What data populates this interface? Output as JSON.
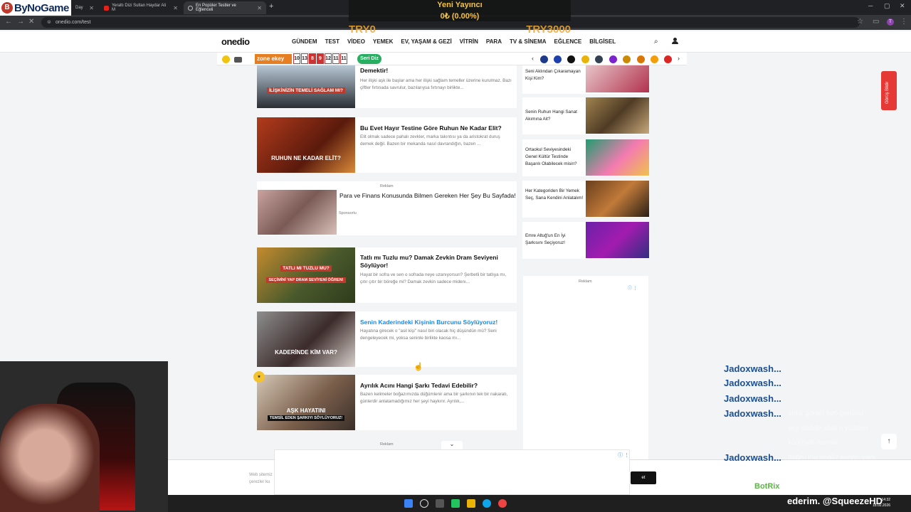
{
  "browser": {
    "tabs": [
      {
        "label": "Day",
        "active": false
      },
      {
        "label": "Yeraltı Dizi Sultan Haydar Ali M",
        "active": false
      },
      {
        "label": "En Popüler Testler ve Eğlenceli",
        "active": true
      }
    ],
    "url": "onedio.com/test",
    "profile_initial": "T"
  },
  "overlay": {
    "logo_text": "ByNoGame",
    "donation_title": "Yeni Yayıncı",
    "donation_value": "0₺ (0.00%)",
    "donation_min": "TRY0",
    "donation_max": "TRY3000"
  },
  "site": {
    "logo": "onedio",
    "nav": [
      "GÜNDEM",
      "TEST",
      "VİDEO",
      "YEMEK",
      "EV, YAŞAM & GEZİ",
      "VİTRİN",
      "PARA",
      "TV & SİNEMA",
      "EĞLENCE",
      "BİLGİSEL"
    ],
    "zone_logo": "zone ekey",
    "date_numbers": [
      "10",
      "13",
      "8",
      "9",
      "12",
      "11",
      "11"
    ],
    "seri_diz": "Seri Diz"
  },
  "articles": [
    {
      "title": "Demektir!",
      "desc": "Her ilişki aşk ile başlar ama her ilişki sağlam temeller üzerine kurulmaz. Bazı çiftler fırtınada savrulur, bazılarıysa fırtınayı birlikte...",
      "caption": "İLİŞKİNİZİN TEMELİ SAĞLAM MI?"
    },
    {
      "title": "Bu Evet Hayır Testine Göre Ruhun Ne Kadar Elit?",
      "desc": "Elit olmak sadece pahalı zevkler, marka takıntısı ya da aristokrat duruş demek değil. Bazen bir mekanda nasıl davrandığın, bazen ...",
      "caption": "RUHUN NE KADAR ELİT?"
    },
    {
      "title": "Tatlı mı Tuzlu mu? Damak Zevkin Dram Seviyeni Söylüyor!",
      "desc": "Hayat bir sofra ve sen o sofrada neye uzanıyorsun? Şerbetli bir tatlıya mı, çıtır çıtır bir böreğe mi? Damak zevkin sadece midenı...",
      "caption": "TATLI MI TUZLU MU?"
    },
    {
      "title": "Senin Kaderindeki Kişinin Burcunu Söylüyoruz!",
      "desc": "Hayatına girecek o \"asil kişi\" nasıl biri olacak hiç düşündün mü? Seni dengeleyecek mi, yoksa seninle birlikte kaosa mı...",
      "caption": "KADERİNDE KİM VAR?"
    },
    {
      "title": "Ayrılık Acını Hangi Şarkı Tedavi Edebilir?",
      "desc": "Bazen kelimeler boğazımızda düğümlenir ama bir şarkının tek bir nakaratı, günlerdir anlatamadığımız her şeyi haykırır. Ayrılık,...",
      "caption": "AŞK HAYATINI"
    }
  ],
  "captions_extra": {
    "tatli_sub": "SEÇİMİNİ YAP DRAM SEVİYENİ ÖĞREN!",
    "ask_sub": "TEMSİL EDEN ŞARKIYI SÖYLÜYORUZ!"
  },
  "sponsored": {
    "reklam": "Reklam",
    "title": "Para ve Finans Konusunda Bilmen Gereken Her Şey Bu Sayfada!",
    "label": "Sponsorlu"
  },
  "sidebar": [
    {
      "text": "Seni Aklından Çıkaramayan Kişi Kim?"
    },
    {
      "text": "Senin Ruhun Hangi Sanat Akımına Ait?"
    },
    {
      "text": "Ortaokul Seviyesindeki Genel Kültür Testinde Başarılı Olabilecek misin?"
    },
    {
      "text": "Her Kategoriden Bir Yemek Seç, Sana Kendini Anlatalım!"
    },
    {
      "text": "Emre Altuğ'un En İyi Şarkısını Seçiyoruz!"
    }
  ],
  "side_reklam": "Reklam",
  "bottom_reklam": "Reklam",
  "feedback": "Görüş Bildir",
  "cookie": {
    "text": "Web sitemiz çerezler ku",
    "ok": "et"
  },
  "chat": {
    "names": [
      "Jadoxwash...",
      "Jadoxwash...",
      "Jadoxwash...",
      "Jadoxwash...",
      "Jadoxwash..."
    ],
    "messages": [
      "anlık görsel son görüldü",
      "şey olabilir abla o yüzden",
      "korkmak normal",
      "doğru mu analiz ediyor yani",
      "abla bu testler"
    ],
    "bot_name": "BotRix",
    "bot_msg": "Takip ettiğiniz için teşekkür",
    "ticker": "ederim. @SqueezeHD"
  },
  "clock": {
    "time": "14:32",
    "date": "18.02.2026"
  }
}
